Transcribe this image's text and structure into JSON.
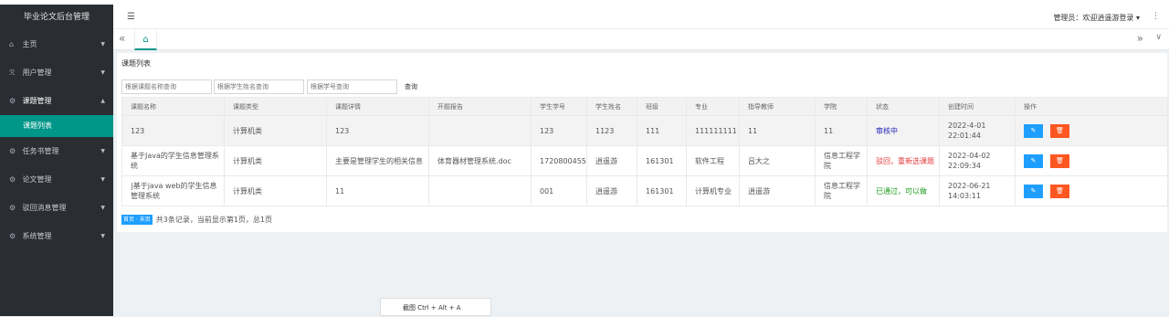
{
  "app": {
    "title": "毕业论文后台管理"
  },
  "sidebar": {
    "items": [
      {
        "label": "主页",
        "icon": "home-icon",
        "glyph": "⌂",
        "arrow": "▼"
      },
      {
        "label": "用户管理",
        "icon": "user-icon",
        "glyph": "ℛ",
        "arrow": "▼"
      },
      {
        "label": "课题管理",
        "icon": "gear-icon",
        "glyph": "⚙",
        "arrow": "▲",
        "sub": "课题列表"
      },
      {
        "label": "任务书管理",
        "icon": "gear-icon",
        "glyph": "⚙",
        "arrow": "▼"
      },
      {
        "label": "论文管理",
        "icon": "gear-icon",
        "glyph": "⚙",
        "arrow": "▼"
      },
      {
        "label": "驳回消息管理",
        "icon": "gear-icon",
        "glyph": "⚙",
        "arrow": "▼"
      },
      {
        "label": "系统管理",
        "icon": "gear-icon",
        "glyph": "⚙",
        "arrow": "▼"
      }
    ]
  },
  "header": {
    "user": "管理员：欢迎逍遥游登录 ▾",
    "menu_glyph": "☰",
    "more_glyph": "⋮"
  },
  "tabs": {
    "left_glyph": "«",
    "home_glyph": "⌂",
    "right_glyph": "»",
    "down_glyph": "∨"
  },
  "card": {
    "title": "课题列表"
  },
  "search": {
    "topic_placeholder": "根据课题名称查询",
    "student_placeholder": "根据学生姓名查询",
    "number_placeholder": "根据学号查询",
    "button": "查询"
  },
  "table": {
    "headers": [
      "课题名称",
      "课题类型",
      "课题详情",
      "开题报告",
      "学生学号",
      "学生姓名",
      "班级",
      "专业",
      "指导教师",
      "学院",
      "状态",
      "创建时间",
      "操作"
    ],
    "rows": [
      [
        "123",
        "计算机类",
        "123",
        "",
        "123",
        "1123",
        "111",
        "111111111",
        "11",
        "11",
        "审核中",
        "2022-4-01 22:01:44"
      ],
      [
        "基于Java的学生信息管理系统",
        "计算机类",
        "主要是管理学生的相关信息",
        "体育器材管理系统.doc",
        "1720800455",
        "逍遥游",
        "161301",
        "软件工程",
        "吕大之",
        "信息工程学院",
        "驳回，重新选课题",
        "2022-04-02 22:09:34"
      ],
      [
        "|基于java web的学生信息管理系统",
        "计算机类",
        "11",
        "",
        "001",
        "逍遥游",
        "161301",
        "计算机专业",
        "逍遥游",
        "信息工程学院",
        "已通过，可以做",
        "2022-06-21 14:03:11"
      ]
    ],
    "status_colors": [
      "#2323b8",
      "#e23d3d",
      "#1e9a1e"
    ],
    "edit_glyph": "✎",
    "delete_glyph": "🗑"
  },
  "pager": {
    "pages": "首页 · 末页",
    "summary": "共3条记录，当前显示第1页，总1页"
  },
  "tooltip": {
    "text": "截图 Ctrl + Alt + A"
  }
}
